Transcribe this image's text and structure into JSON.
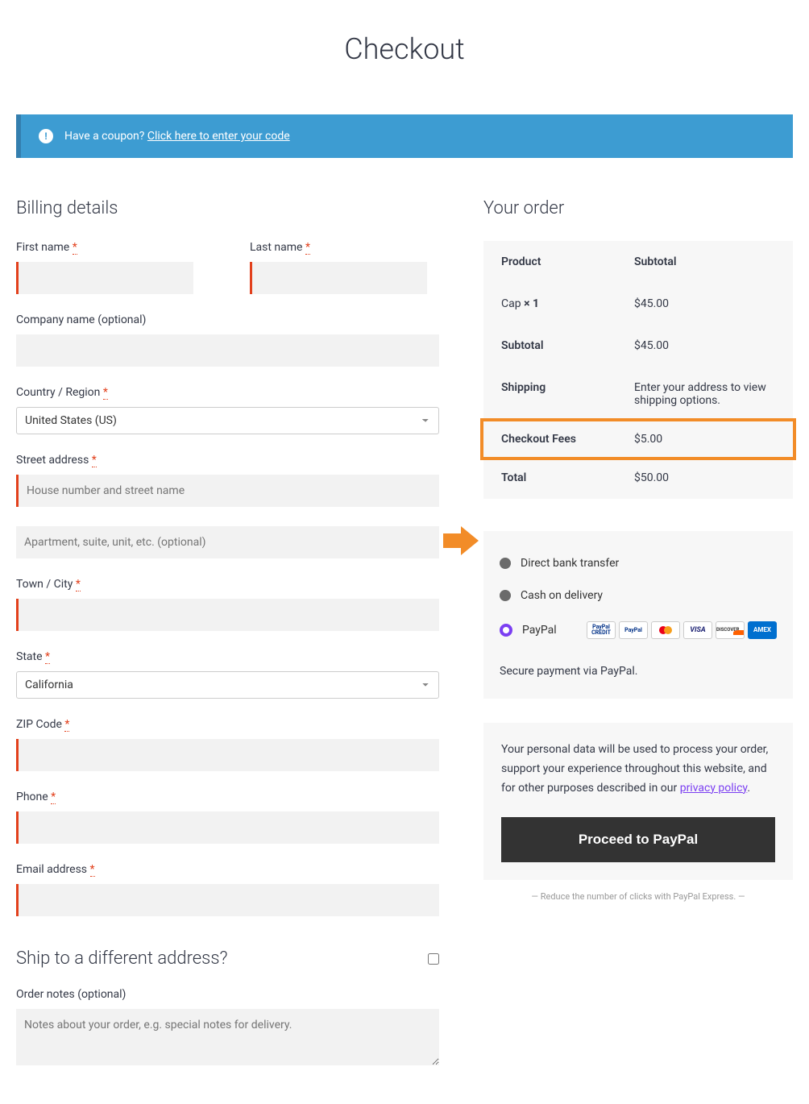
{
  "page_title": "Checkout",
  "coupon": {
    "prompt": "Have a coupon? ",
    "link": "Click here to enter your code"
  },
  "billing": {
    "heading": "Billing details",
    "first_name_label": "First name",
    "last_name_label": "Last name",
    "company_label": "Company name (optional)",
    "country_label": "Country / Region",
    "country_value": "United States (US)",
    "street_label": "Street address",
    "street_placeholder": "House number and street name",
    "apt_placeholder": "Apartment, suite, unit, etc. (optional)",
    "city_label": "Town / City",
    "state_label": "State",
    "state_value": "California",
    "zip_label": "ZIP Code",
    "phone_label": "Phone",
    "email_label": "Email address"
  },
  "shipping": {
    "heading": "Ship to a different address?",
    "notes_label": "Order notes (optional)",
    "notes_placeholder": "Notes about your order, e.g. special notes for delivery."
  },
  "order": {
    "heading": "Your order",
    "product_h": "Product",
    "subtotal_h": "Subtotal",
    "item_name": "Cap ",
    "item_qty": " × 1",
    "item_price": "$45.00",
    "subtotal_label": "Subtotal",
    "subtotal_value": "$45.00",
    "shipping_label": "Shipping",
    "shipping_value": "Enter your address to view shipping options.",
    "fees_label": "Checkout Fees",
    "fees_value": "$5.00",
    "total_label": "Total",
    "total_value": "$50.00"
  },
  "payment": {
    "bank": "Direct bank transfer",
    "cod": "Cash on delivery",
    "paypal": "PayPal",
    "cards": {
      "credit": "PayPal CREDIT",
      "paypal": "PayPal",
      "mc": "●●",
      "visa": "VISA",
      "discover": "DISCOVER",
      "amex": "AMEX"
    },
    "secure": "Secure payment via PayPal."
  },
  "privacy": {
    "text": "Your personal data will be used to process your order, support your experience throughout this website, and for other purposes described in our ",
    "link": "privacy policy",
    "period": "."
  },
  "button": "Proceed to PayPal",
  "footnote": "— Reduce the number of clicks with PayPal Express. —",
  "required_mark": "*"
}
